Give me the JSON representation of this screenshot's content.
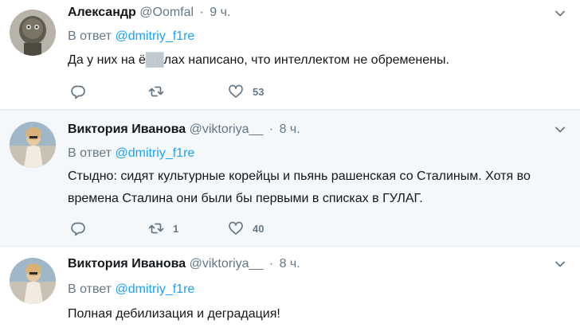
{
  "tweets": [
    {
      "author_name": "Александр",
      "author_handle": "@Oomfal",
      "time": "9 ч.",
      "reply_prefix": "В ответ",
      "reply_mention": "@dmitriy_f1re",
      "text_before": "Да у них на ё",
      "text_censored": "██",
      "text_after": "лах написано, что интеллектом не обременены.",
      "retweets": "",
      "likes": "53",
      "avatar_colors": {
        "bg": "#b7b3aa",
        "figure": "#5f5a4e"
      }
    },
    {
      "author_name": "Виктория Иванова",
      "author_handle": "@viktoriya__",
      "time": "8 ч.",
      "reply_prefix": "В ответ",
      "reply_mention": "@dmitriy_f1re",
      "text": "Стыдно: сидят культурные корейцы и пьянь рашенская со Сталиным. Хотя во времена Сталина они были бы первыми в списках в ГУЛАГ.",
      "retweets": "1",
      "likes": "40",
      "avatar_colors": {
        "bg": "#9fb7c6",
        "figure": "#e8d6c0"
      }
    },
    {
      "author_name": "Виктория Иванова",
      "author_handle": "@viktoriya__",
      "time": "8 ч.",
      "reply_prefix": "В ответ",
      "reply_mention": "@dmitriy_f1re",
      "text": "Полная дебилизация и деградация!",
      "avatar_colors": {
        "bg": "#9fb7c6",
        "figure": "#e8d6c0"
      }
    }
  ],
  "colors": {
    "link": "#1da1f2",
    "secondary_text": "#657786",
    "primary_text": "#14171a",
    "highlight_bg": "#f5f8fa",
    "divider": "#e6ecf0"
  },
  "icons": [
    "reply-icon",
    "retweet-icon",
    "like-icon",
    "caret-down-icon",
    "avatar"
  ]
}
